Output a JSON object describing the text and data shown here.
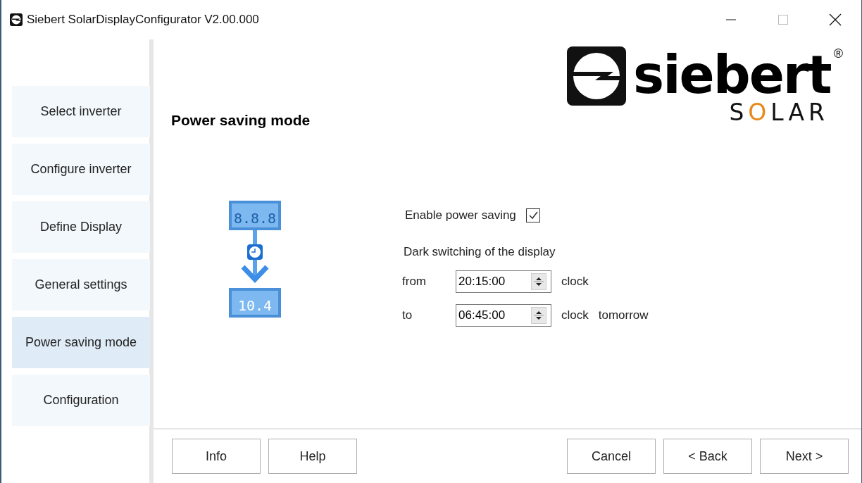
{
  "window": {
    "title": "Siebert SolarDisplayConfigurator V2.00.000"
  },
  "logo": {
    "name": "siebert",
    "mark": "®",
    "subtitle": [
      {
        "text": "S",
        "accent": false
      },
      {
        "text": "O",
        "accent": true
      },
      {
        "text": "LAR",
        "accent": false
      }
    ]
  },
  "sidebar": {
    "items": [
      {
        "label": "Select inverter",
        "selected": false
      },
      {
        "label": "Configure inverter",
        "selected": false
      },
      {
        "label": "Define Display",
        "selected": false
      },
      {
        "label": "General settings",
        "selected": false
      },
      {
        "label": "Power saving mode",
        "selected": true
      },
      {
        "label": "Configuration",
        "selected": false
      }
    ]
  },
  "page": {
    "heading": "Power saving mode"
  },
  "illustration": {
    "before": "8.8.8",
    "after": "10.4"
  },
  "form": {
    "enable": {
      "label": "Enable power saving",
      "checked": true
    },
    "section_label": "Dark switching of the display",
    "rows": [
      {
        "label": "from",
        "value": "20:15:00",
        "unit": "clock"
      },
      {
        "label": "to",
        "value": "06:45:00",
        "unit": "clock",
        "note": "tomorrow"
      }
    ]
  },
  "buttons_left": [
    "Info",
    "Help"
  ],
  "buttons_right": [
    "Cancel",
    "< Back",
    "Next >"
  ]
}
